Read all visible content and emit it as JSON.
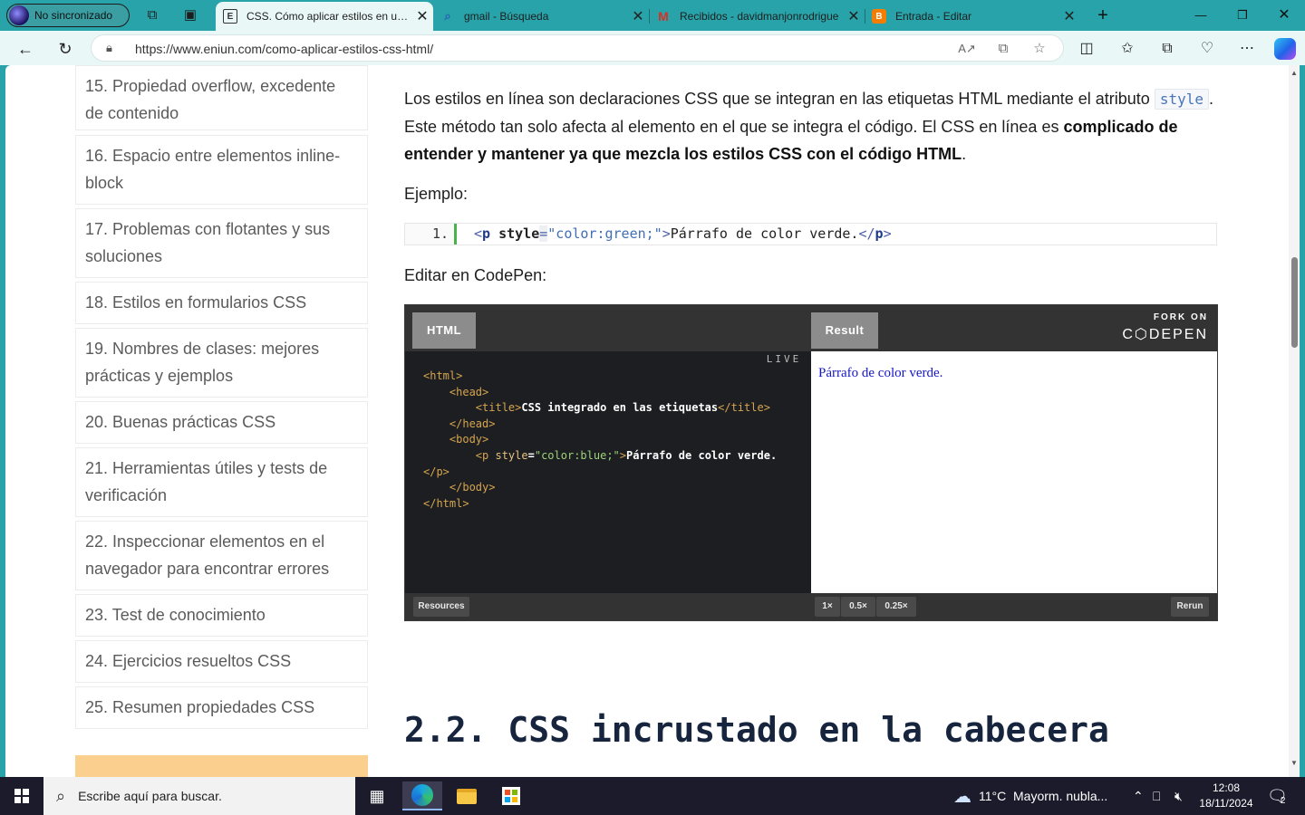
{
  "browser": {
    "profile_label": "No sincronizado",
    "tabs": [
      {
        "title": "CSS. Cómo aplicar estilos en un d",
        "favicon": "E"
      },
      {
        "title": "gmail - Búsqueda",
        "favicon": "search"
      },
      {
        "title": "Recibidos - davidmanjonrodrigue",
        "favicon": "gmail"
      },
      {
        "title": "Entrada - Editar",
        "favicon": "blogger"
      }
    ],
    "url": "https://www.eniun.com/como-aplicar-estilos-css-html/"
  },
  "toc": {
    "items": [
      "15. Propiedad overflow, excedente de contenido",
      "16. Espacio entre elementos inline-block",
      "17. Problemas con flotantes y sus soluciones",
      "18. Estilos en formularios CSS",
      "19. Nombres de clases: mejores prácticas y ejemplos",
      "20. Buenas prácticas CSS",
      "21. Herramientas útiles y tests de verificación",
      "22. Inspeccionar elementos en el navegador para encontrar errores",
      "23. Test de conocimiento",
      "24. Ejercicios resueltos CSS",
      "25. Resumen propiedades CSS"
    ]
  },
  "article": {
    "p1_a": "Los estilos en línea son declaraciones CSS que se integran en las etiquetas HTML mediante el atributo ",
    "p1_code": "style",
    "p1_b": ". Este método tan solo afecta al elemento en el que se integra el código. El CSS en línea es ",
    "p1_bold": "complicado de entender y mantener ya que mezcla los estilos CSS con el código HTML",
    "p1_end": ".",
    "example_label": "Ejemplo:",
    "code_line_number": "1.",
    "code": {
      "open": "<",
      "tag": "p",
      "attr": "style",
      "eq": "=",
      "value": "\"color:green;\"",
      "close_open": ">",
      "text": "Párrafo de color verde.",
      "end_open": "</",
      "end_tag": "p",
      "end_close": ">"
    },
    "codepen_label": "Editar en CodePen:",
    "heading": "2.2. CSS incrustado en la cabecera"
  },
  "codepen": {
    "tab_html": "HTML",
    "tab_result": "Result",
    "fork_line1": "FORK ON",
    "fork_line2": "C⬡DEPEN",
    "live": "LIVE",
    "code_lines": {
      "l1": "<html>",
      "l2": "<head>",
      "l3_tag_open": "<title>",
      "l3_text": "CSS integrado en las etiquetas",
      "l3_tag_close": "</title>",
      "l4": "</head>",
      "l5": "<body>",
      "l6_open": "<p ",
      "l6_attr": "style",
      "l6_eq": "=",
      "l6_val": "\"color:blue;\"",
      "l6_gt": ">",
      "l6_text": "Párrafo de color verde.",
      "l7": "</p>",
      "l8": "</body>",
      "l9": "</html>"
    },
    "result_text": "Párrafo de color verde.",
    "resources": "Resources",
    "zoom": [
      "1×",
      "0.5×",
      "0.25×"
    ],
    "rerun": "Rerun"
  },
  "taskbar": {
    "search_placeholder": "Escribe aquí para buscar.",
    "weather": "11°C  Mayorm. nubla...",
    "time": "12:08",
    "date": "18/11/2024",
    "notifications": "2"
  },
  "colors": {
    "accent_teal": "#27a3a9",
    "codepen_bg": "#1d1e22",
    "result_text": "#1515c9",
    "promo": "#fbd08e"
  }
}
